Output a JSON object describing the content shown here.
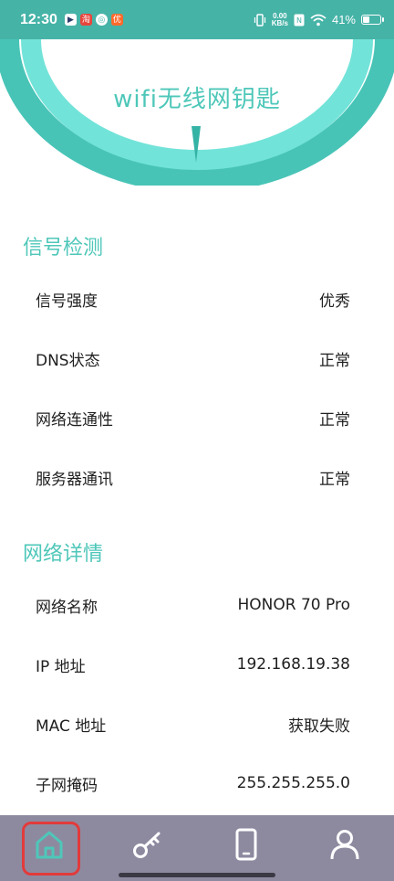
{
  "status_bar": {
    "time": "12:30",
    "notifications": [
      "▶",
      "淘",
      "◎",
      "优"
    ],
    "net_speed_value": "0.00",
    "net_speed_unit": "KB/s",
    "battery": "41%",
    "battery_level": 0.41
  },
  "header": {
    "title": "wifi无线网钥匙"
  },
  "signal_section": {
    "title": "信号检测",
    "rows": [
      {
        "label": "信号强度",
        "value": "优秀"
      },
      {
        "label": "DNS状态",
        "value": "正常"
      },
      {
        "label": "网络连通性",
        "value": "正常"
      },
      {
        "label": "服务器通讯",
        "value": "正常"
      }
    ]
  },
  "network_section": {
    "title": "网络详情",
    "rows": [
      {
        "label": "网络名称",
        "value": "HONOR 70 Pro"
      },
      {
        "label": "IP 地址",
        "value": "192.168.19.38"
      },
      {
        "label": "MAC 地址",
        "value": "获取失败"
      },
      {
        "label": "子网掩码",
        "value": "255.255.255.0"
      }
    ]
  },
  "bottom_nav": {
    "items": [
      {
        "icon": "home-icon",
        "selected": true
      },
      {
        "icon": "key-icon",
        "selected": false
      },
      {
        "icon": "phone-icon",
        "selected": false
      },
      {
        "icon": "user-icon",
        "selected": false
      }
    ]
  },
  "colors": {
    "accent": "#4ec7b9",
    "status_bar": "#46b3a7",
    "nav_background": "#8d8aa0",
    "highlight": "#e23b3b"
  }
}
